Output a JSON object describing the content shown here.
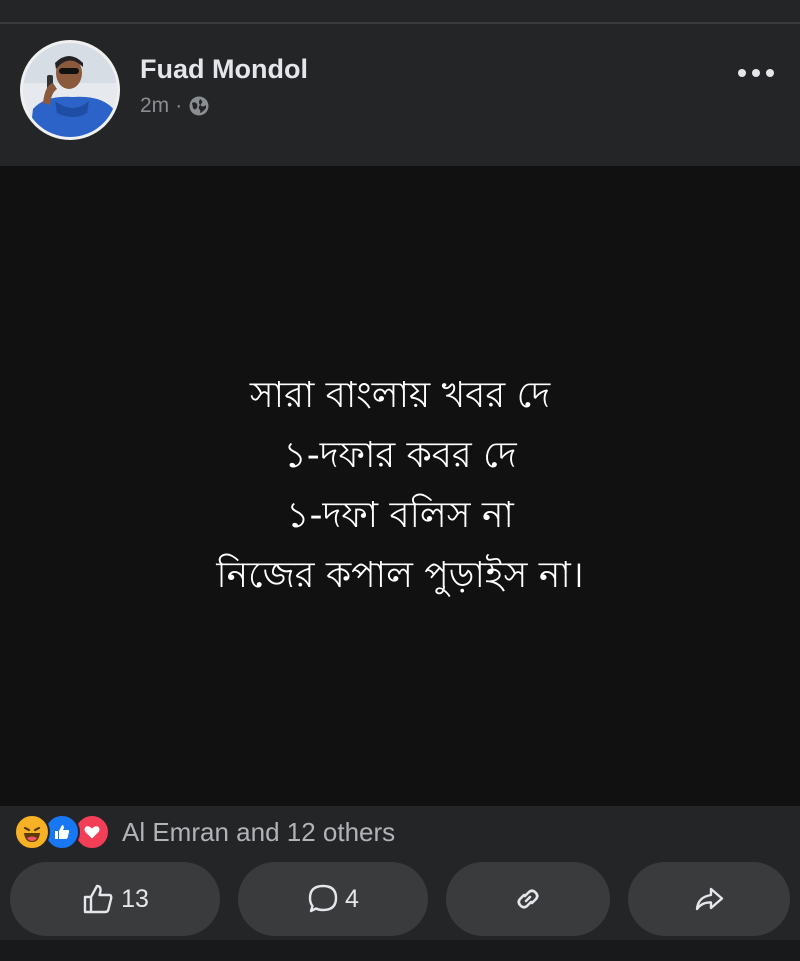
{
  "post": {
    "author": "Fuad Mondol",
    "time": "2m",
    "separator": "·",
    "body_lines": [
      "সারা বাংলায় খবর দে",
      "১-দফার কবর দে",
      "১-দফা বলিস না",
      "নিজের কপাল পুড়াইস না।"
    ]
  },
  "reactions": {
    "icons": [
      "haha-icon",
      "like-icon",
      "love-icon"
    ],
    "summary": "Al Emran and 12 others"
  },
  "actions": {
    "like_count": "13",
    "comment_count": "4"
  },
  "colors": {
    "background": "#242526",
    "post_body": "#111111",
    "button": "#3a3b3c",
    "like_blue": "#1877f2",
    "love_red": "#f33e58",
    "haha_yellow": "#f7b125"
  }
}
